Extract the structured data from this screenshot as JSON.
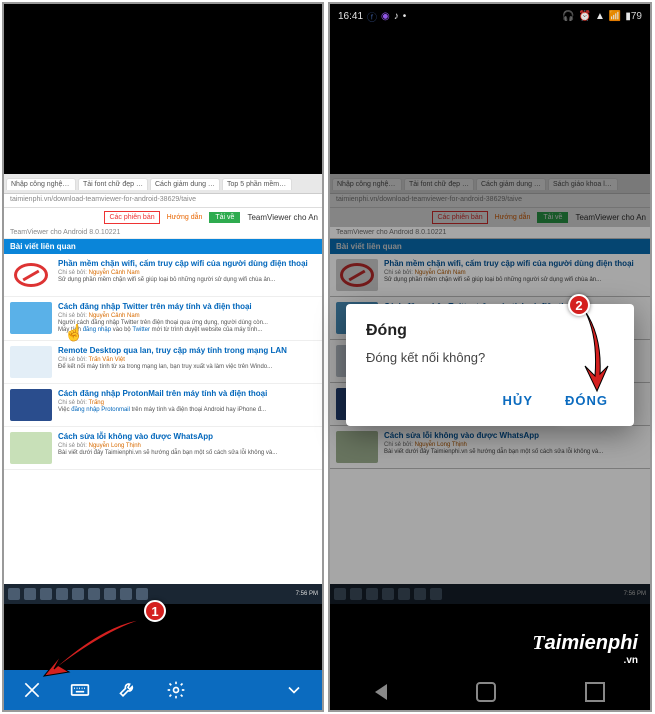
{
  "statusbar": {
    "time": "16:41",
    "battery": "79",
    "icons": [
      "facebook",
      "messenger",
      "tiktok",
      "more"
    ],
    "right_icons": [
      "headphones",
      "alarm",
      "wifi",
      "signal",
      "battery"
    ]
  },
  "browser": {
    "url": "taimienphi.vn/download-teamviewer-for-android-38629/taive",
    "tabs": [
      "Nhập công nghệ và...",
      "Tải font chữ đẹp online, thủ...",
      "Cách giảm dung lượng ảnh, né...",
      "Top 5 phần mềm học tiếng an..."
    ],
    "tabs_right": [
      "Nhập công nghệ và...",
      "Tải font chữ đẹp onli...",
      "Cách giảm dung lượng...",
      "Sách giáo khoa lớp..."
    ]
  },
  "page": {
    "btn_versions": "Các phiên bản",
    "btn_guide": "Hướng dẫn",
    "btn_download": "Tải về",
    "title": "TeamViewer cho An",
    "subtitle": "TeamViewer cho Android 8.0.10221",
    "section": "Bài viết liên quan"
  },
  "articles": [
    {
      "title": "Phần mềm chặn wifi, cấm truy cập wifi của người dùng điện thoại",
      "meta_prefix": "Chi sẻ bởi:",
      "author": "Nguyễn Cảnh Nam",
      "text": "Sử dụng phần mềm chặn wifi sẽ giúp loại bỏ những người sử dụng wifi chùa ản..."
    },
    {
      "title": "Cách đăng nhập Twitter trên máy tính và điện thoại",
      "meta_prefix": "Chi sẻ bởi:",
      "author": "Nguyễn Cảnh Nam",
      "text": "Người cách đăng nhập Twitter trên điện thoại qua ứng dụng, người dùng còn...",
      "text2_pre": "Máy tính",
      "text2_link": "đăng nhập",
      "text2_mid": "vào bộ",
      "text2_link2": "Twitter",
      "text2_post": "mới từ trình duyệt website của máy tính..."
    },
    {
      "title": "Remote Desktop qua lan, truy cập máy tính trong mạng LAN",
      "meta_prefix": "Chi sẻ bởi:",
      "author": "Trấn Văn Việt",
      "text": "Để kết nối máy tính từ xa trong mạng lan, bạn truy xuất và làm việc trên Windo..."
    },
    {
      "title": "Cách đăng nhập ProtonMail trên máy tính và điện thoại",
      "meta_prefix": "Chi sẻ bởi:",
      "author": "Trấng",
      "text_pre": "Việc",
      "text_link": "đăng nhập Protonmail",
      "text_post": "trên máy tính và điện thoại Android hay iPhone đ..."
    },
    {
      "title": "Cách sửa lỗi không vào được WhatsApp",
      "meta_prefix": "Chi sẻ bởi:",
      "author": "Nguyễn Long Thịnh",
      "text": "Bài viết dưới đây Taimienphi.vn sẽ hướng dẫn bạn một số cách sửa lỗi không và..."
    }
  ],
  "tv_toolbar": {
    "close": "close",
    "keyboard": "keyboard",
    "wrench": "settings-wrench",
    "gear": "settings-gear",
    "collapse": "collapse"
  },
  "dialog": {
    "title": "Đóng",
    "message": "Đóng kết nối không?",
    "cancel": "HỦY",
    "confirm": "ĐÓNG"
  },
  "callouts": {
    "one": "1",
    "two": "2"
  },
  "watermark": {
    "brand": "Taimienphi",
    "tld": ".vn"
  },
  "taskbar_time": "7:56 PM"
}
